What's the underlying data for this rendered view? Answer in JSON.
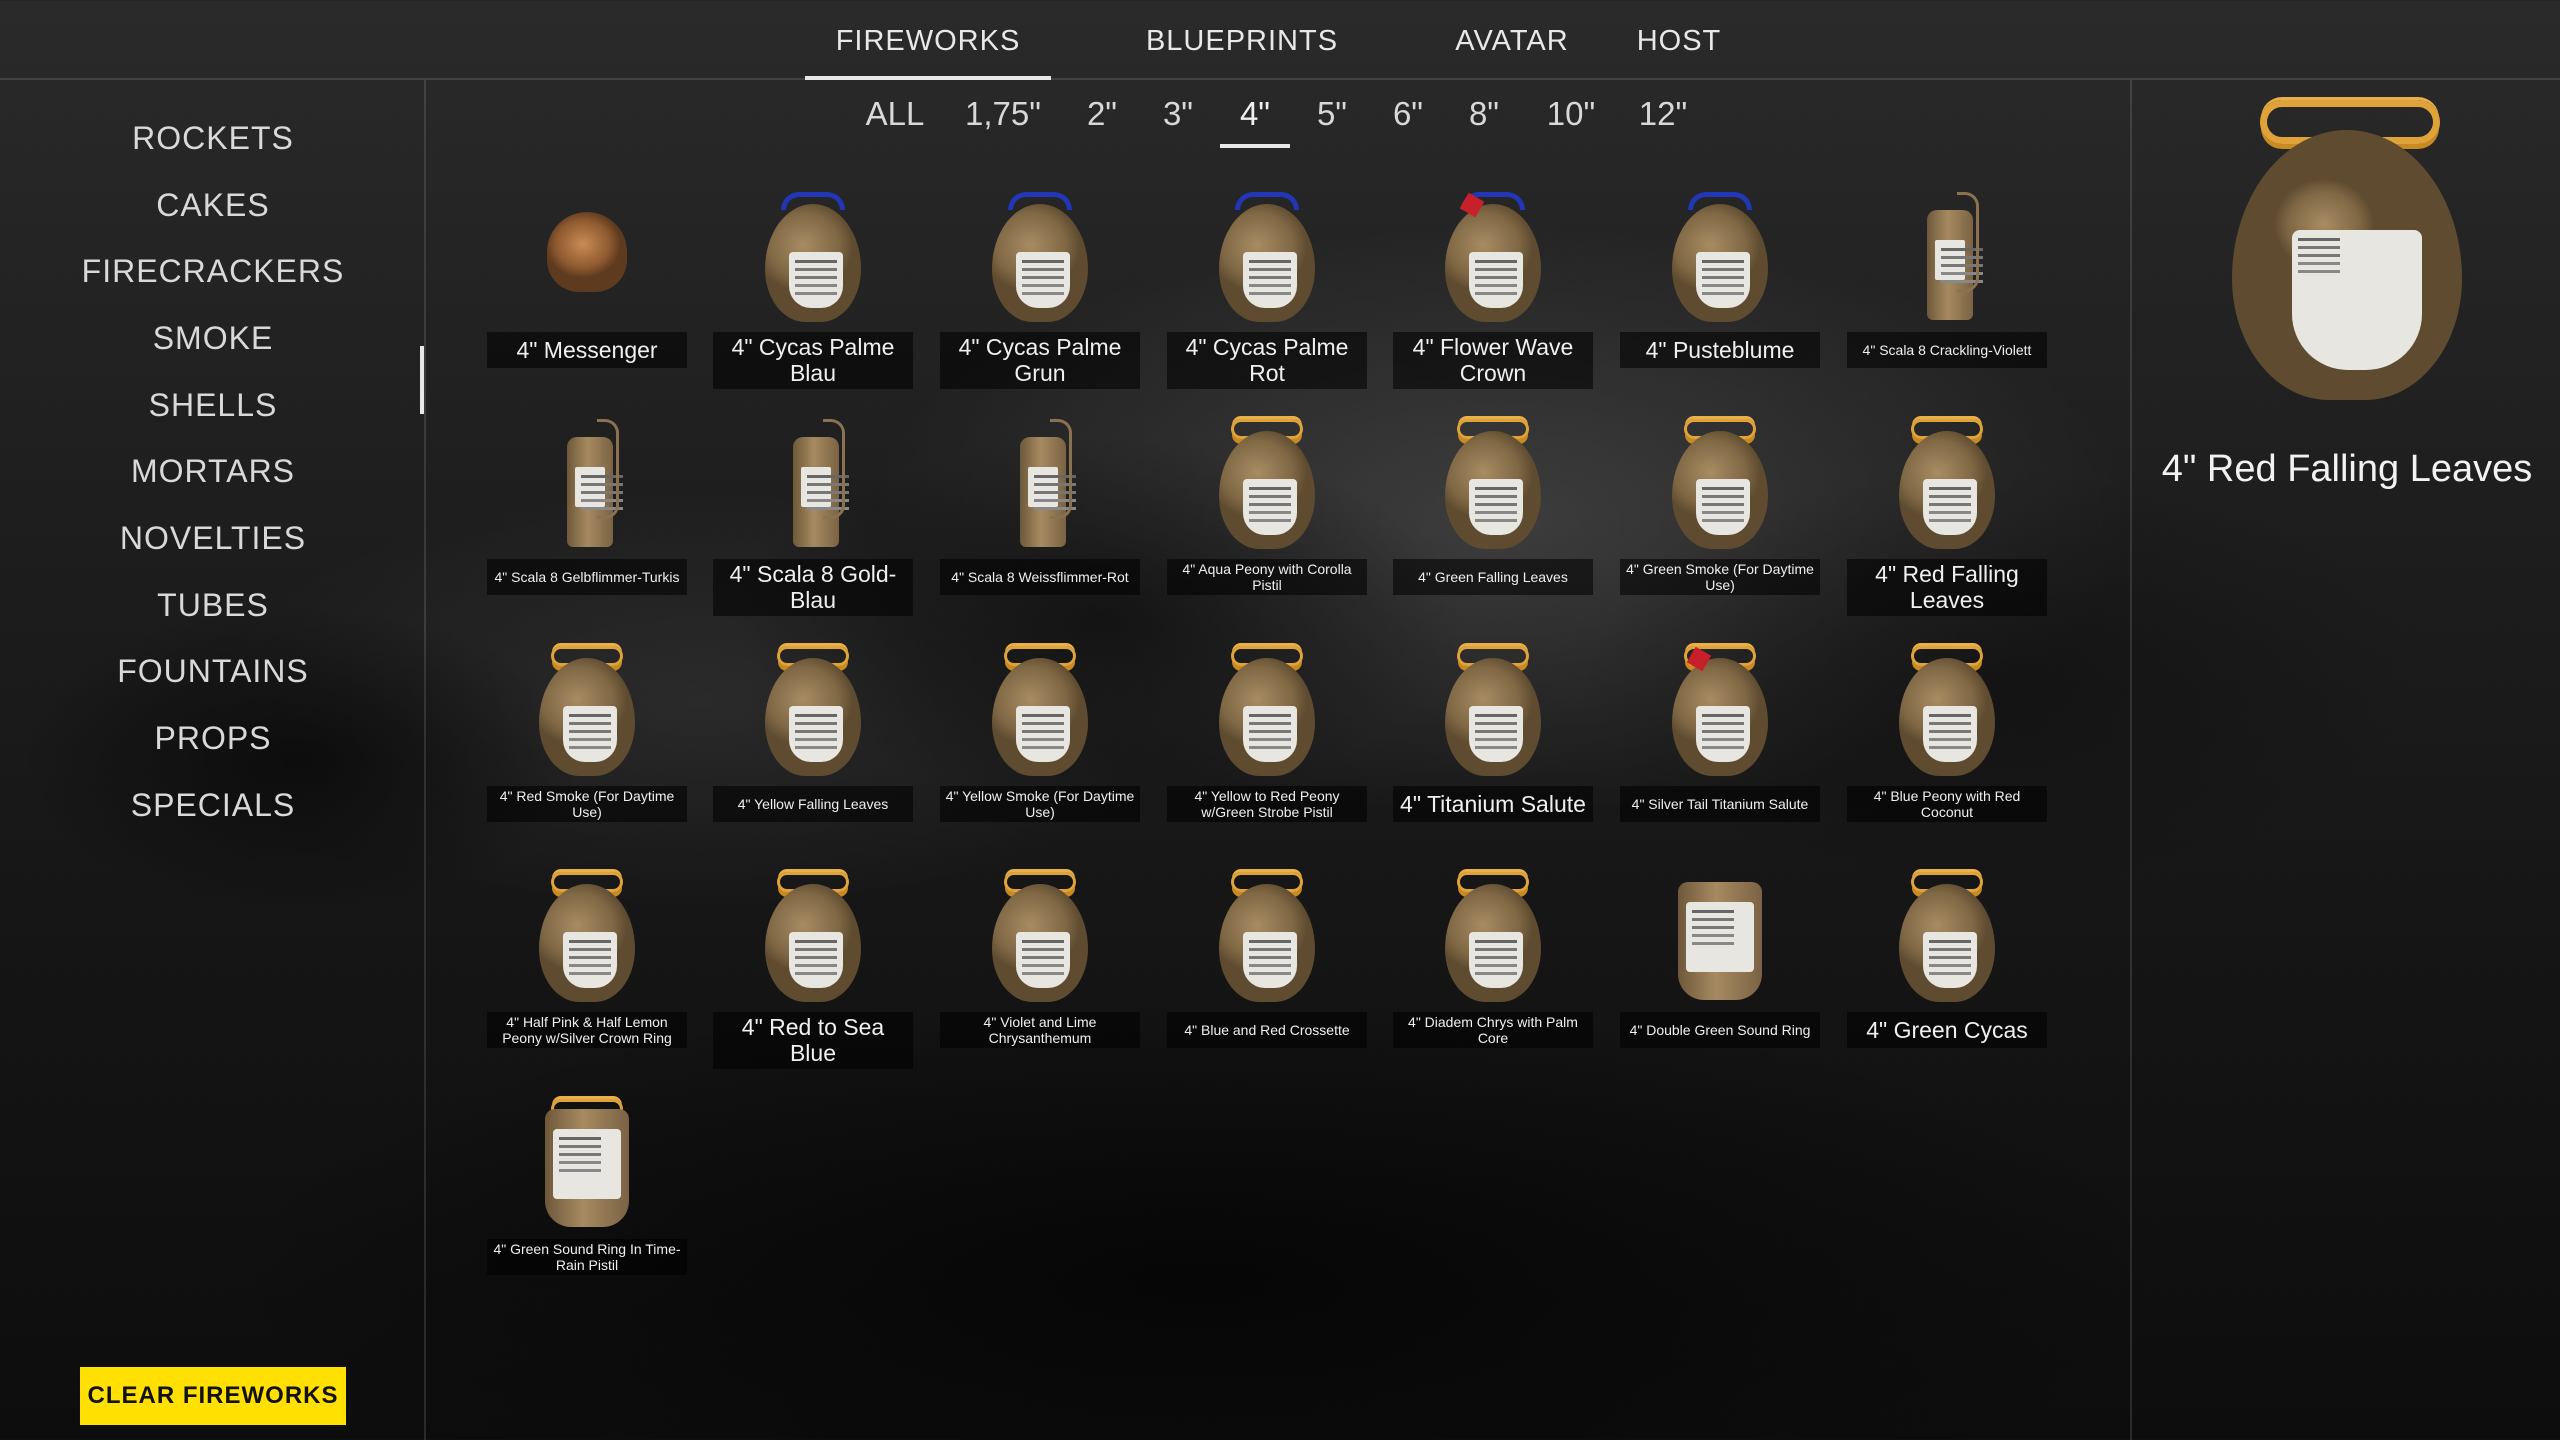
{
  "top_tabs": [
    {
      "label": "FIREWORKS",
      "active": true
    },
    {
      "label": "BLUEPRINTS",
      "active": false
    },
    {
      "label": "AVATAR",
      "active": false
    },
    {
      "label": "HOST",
      "active": false
    }
  ],
  "sidebar": {
    "items": [
      "ROCKETS",
      "CAKES",
      "FIRECRACKERS",
      "SMOKE",
      "SHELLS",
      "MORTARS",
      "NOVELTIES",
      "TUBES",
      "FOUNTAINS",
      "PROPS",
      "SPECIALS"
    ],
    "active": "SHELLS",
    "clear_button": "CLEAR FIREWORKS"
  },
  "size_filters": {
    "items": [
      "ALL",
      "1,75\"",
      "2\"",
      "3\"",
      "4\"",
      "5\"",
      "6\"",
      "8\"",
      "10\"",
      "12\""
    ],
    "active": "4\""
  },
  "preview": {
    "title": "4\" Red Falling Leaves",
    "icon": "shell-gold-fuse"
  },
  "colors": {
    "accent_yellow": "#ffe000",
    "fuse_blue": "#2236b8",
    "fuse_gold": "#e0a33a",
    "fuse_red": "#c8202a"
  },
  "items": [
    {
      "name": "4\" Messenger",
      "icon": "messenger"
    },
    {
      "name": "4\" Cycas Palme Blau",
      "icon": "blue-fuse-shell"
    },
    {
      "name": "4\" Cycas Palme Grun",
      "icon": "blue-fuse-shell"
    },
    {
      "name": "4\" Cycas Palme Rot",
      "icon": "blue-fuse-shell"
    },
    {
      "name": "4\" Flower Wave Crown",
      "icon": "red-blue-fuse-shell"
    },
    {
      "name": "4\" Pusteblume",
      "icon": "blue-fuse-shell"
    },
    {
      "name": "4\" Scala 8 Crackling-Violett",
      "icon": "scala-shell"
    },
    {
      "name": "4\" Scala 8 Gelbflimmer-Turkis",
      "icon": "scala-shell"
    },
    {
      "name": "4\" Scala 8 Gold-Blau",
      "icon": "scala-shell"
    },
    {
      "name": "4\" Scala 8 Weissflimmer-Rot",
      "icon": "scala-shell"
    },
    {
      "name": "4\" Aqua Peony with Corolla Pistil",
      "icon": "gold-fuse-shell"
    },
    {
      "name": "4\" Green Falling Leaves",
      "icon": "gold-fuse-shell"
    },
    {
      "name": "4\" Green Smoke (For Daytime Use)",
      "icon": "gold-fuse-shell"
    },
    {
      "name": "4\" Red Falling Leaves",
      "icon": "gold-fuse-shell"
    },
    {
      "name": "4\" Red Smoke (For Daytime Use)",
      "icon": "gold-fuse-shell"
    },
    {
      "name": "4\" Yellow Falling Leaves",
      "icon": "gold-fuse-shell"
    },
    {
      "name": "4\" Yellow Smoke (For Daytime Use)",
      "icon": "gold-fuse-shell"
    },
    {
      "name": "4\" Yellow to Red Peony w/Green Strobe Pistil",
      "icon": "gold-fuse-shell"
    },
    {
      "name": "4\" Titanium Salute",
      "icon": "gold-fuse-shell"
    },
    {
      "name": "4\" Silver Tail Titanium Salute",
      "icon": "red-gold-fuse-shell"
    },
    {
      "name": "4\" Blue Peony with Red Coconut",
      "icon": "gold-fuse-shell"
    },
    {
      "name": "4\" Half Pink & Half Lemon Peony w/Silver Crown Ring",
      "icon": "gold-fuse-shell"
    },
    {
      "name": "4\" Red to Sea Blue",
      "icon": "gold-fuse-shell"
    },
    {
      "name": "4\" Violet and Lime Chrysanthemum",
      "icon": "gold-fuse-shell"
    },
    {
      "name": "4\" Blue and Red Crossette",
      "icon": "gold-fuse-shell"
    },
    {
      "name": "4\" Diadem Chrys with Palm Core",
      "icon": "gold-fuse-shell"
    },
    {
      "name": "4\" Double Green Sound Ring",
      "icon": "cylinder-shell"
    },
    {
      "name": "4\" Green Cycas",
      "icon": "gold-fuse-shell"
    },
    {
      "name": "4\" Green Sound Ring In Time-Rain Pistil",
      "icon": "cylinder-gold-fuse-shell"
    }
  ]
}
